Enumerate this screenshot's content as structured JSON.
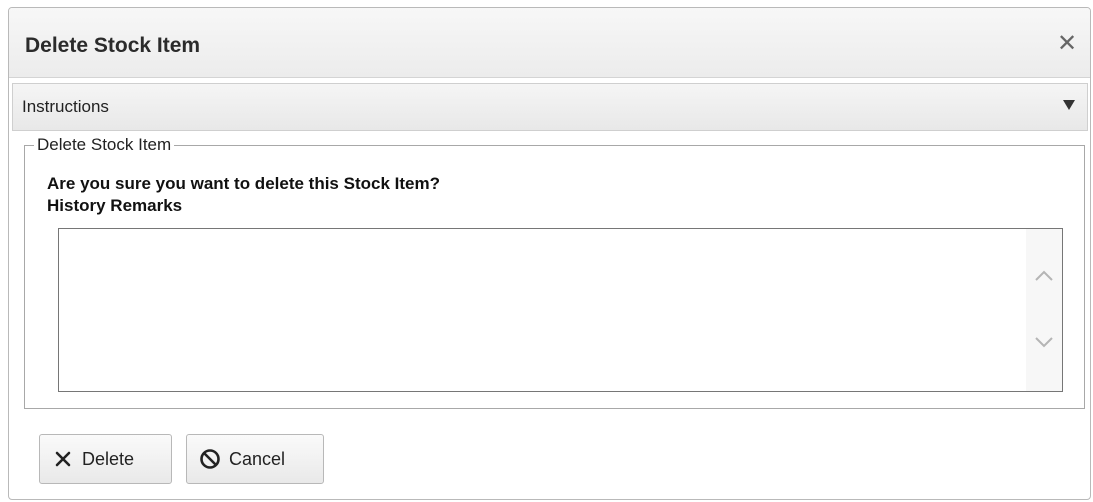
{
  "dialog": {
    "title": "Delete Stock Item",
    "close_icon": "close-icon"
  },
  "instructions": {
    "label": "Instructions",
    "toggle_icon": "caret-down-icon"
  },
  "form": {
    "legend": "Delete Stock Item",
    "question": "Are you sure you want to delete this Stock Item?",
    "remarks_label": "History Remarks",
    "remarks_value": ""
  },
  "buttons": {
    "delete_label": "Delete",
    "delete_icon": "x-icon",
    "cancel_label": "Cancel",
    "cancel_icon": "cancel-circle-icon"
  },
  "colors": {
    "titlebar_bg": "#ececec",
    "border": "#b9b9b9",
    "text": "#222222"
  }
}
